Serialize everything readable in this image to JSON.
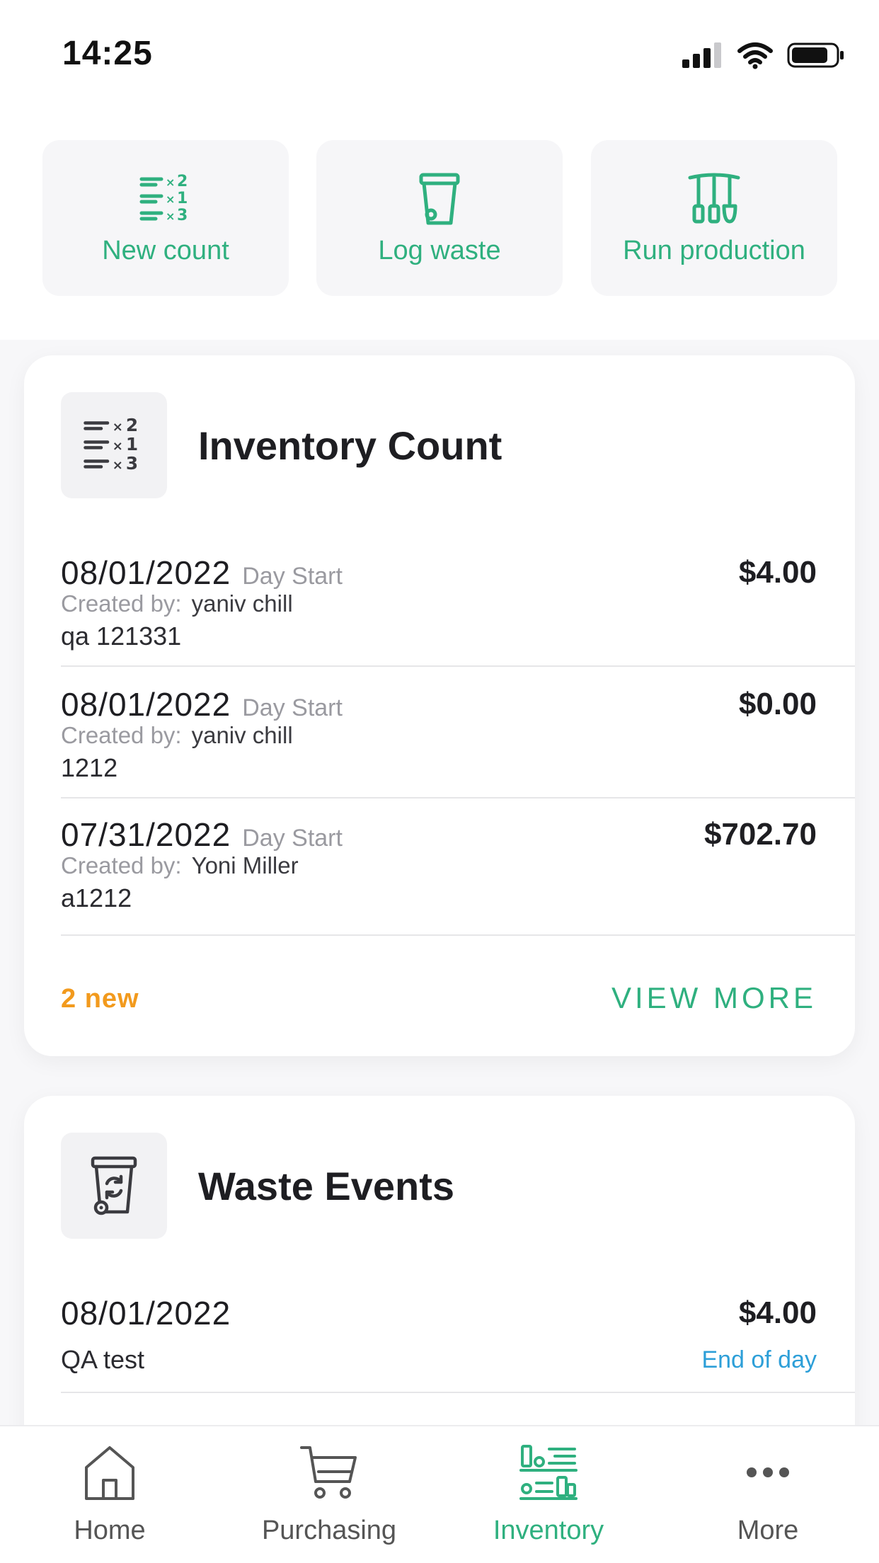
{
  "status_bar": {
    "time": "14:25"
  },
  "quick_actions": [
    {
      "label": "New count",
      "icon": "count-list-icon"
    },
    {
      "label": "Log waste",
      "icon": "trash-bin-icon"
    },
    {
      "label": "Run production",
      "icon": "utensils-icon"
    }
  ],
  "inventory_card": {
    "title": "Inventory Count",
    "rows": [
      {
        "date": "08/01/2022",
        "type": "Day Start",
        "amount": "$4.00",
        "created_label": "Created by:",
        "created_by": "yaniv chill",
        "note": "qa 121331"
      },
      {
        "date": "08/01/2022",
        "type": "Day Start",
        "amount": "$0.00",
        "created_label": "Created by:",
        "created_by": "yaniv chill",
        "note": "1212"
      },
      {
        "date": "07/31/2022",
        "type": "Day Start",
        "amount": "$702.70",
        "created_label": "Created by:",
        "created_by": "Yoni Miller",
        "note": "a1212"
      }
    ],
    "new_count": "2 new",
    "view_more": "VIEW MORE"
  },
  "waste_card": {
    "title": "Waste Events",
    "rows": [
      {
        "date": "08/01/2022",
        "amount": "$4.00",
        "note": "QA test",
        "tag": "End of day"
      }
    ]
  },
  "bottom_nav": [
    {
      "label": "Home",
      "icon": "home-icon",
      "active": false
    },
    {
      "label": "Purchasing",
      "icon": "cart-icon",
      "active": false
    },
    {
      "label": "Inventory",
      "icon": "inventory-icon",
      "active": true
    },
    {
      "label": "More",
      "icon": "more-dots-icon",
      "active": false
    }
  ],
  "colors": {
    "accent_green": "#2fb07f",
    "badge_orange": "#f29a1d",
    "link_blue": "#2d9fd8",
    "icon_gray": "#3b3b40"
  }
}
